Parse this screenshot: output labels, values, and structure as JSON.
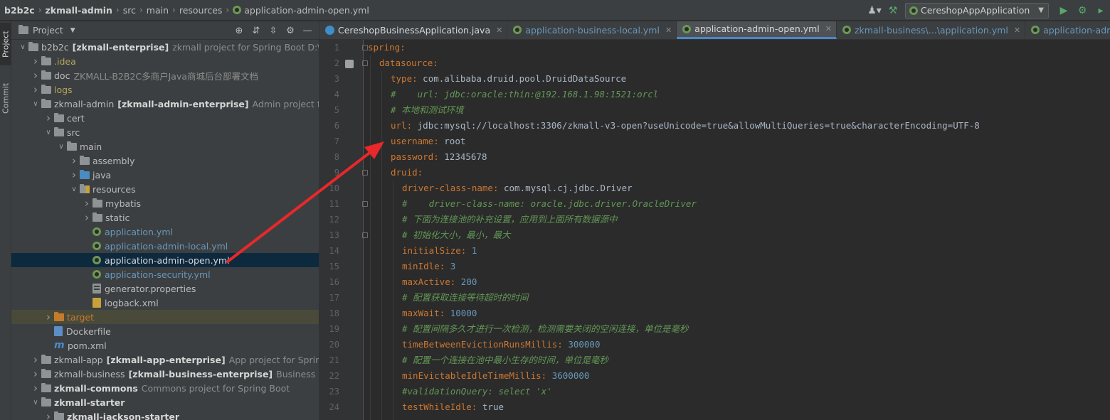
{
  "navbar": {
    "crumbs": [
      "b2b2c",
      "zkmall-admin",
      "src",
      "main",
      "resources",
      "application-admin-open.yml"
    ],
    "run_config": "CereshopAppApplication"
  },
  "stripe": {
    "project_label": "Project",
    "commit_label": "Commit"
  },
  "project_panel": {
    "title": "Project",
    "tree": [
      {
        "name": "b2b2c",
        "bold": "[zkmall-enterprise]",
        "dim": "zkmall project for Spring Boot  D:\\yixian",
        "depth": 0,
        "expanded": true,
        "kind": "folder"
      },
      {
        "name": ".idea",
        "depth": 1,
        "expanded": false,
        "kind": "folder",
        "color": "yellow"
      },
      {
        "name": "doc",
        "dim": "ZKMALL-B2B2C多商户Java商城后台部署文档",
        "depth": 1,
        "expanded": false,
        "kind": "folder"
      },
      {
        "name": "logs",
        "depth": 1,
        "expanded": false,
        "kind": "folder",
        "color": "yellow"
      },
      {
        "name": "zkmall-admin",
        "bold": "[zkmall-admin-enterprise]",
        "dim": "Admin project for Sprin",
        "depth": 1,
        "expanded": true,
        "kind": "folder"
      },
      {
        "name": "cert",
        "depth": 2,
        "expanded": false,
        "kind": "folder"
      },
      {
        "name": "src",
        "depth": 2,
        "expanded": true,
        "kind": "folder"
      },
      {
        "name": "main",
        "depth": 3,
        "expanded": true,
        "kind": "folder"
      },
      {
        "name": "assembly",
        "depth": 4,
        "expanded": false,
        "kind": "folder"
      },
      {
        "name": "java",
        "depth": 4,
        "expanded": false,
        "kind": "folder-blue"
      },
      {
        "name": "resources",
        "depth": 4,
        "expanded": true,
        "kind": "folder-res"
      },
      {
        "name": "mybatis",
        "depth": 5,
        "expanded": false,
        "kind": "folder"
      },
      {
        "name": "static",
        "depth": 5,
        "expanded": false,
        "kind": "folder"
      },
      {
        "name": "application.yml",
        "depth": 5,
        "kind": "yml",
        "color": "blue"
      },
      {
        "name": "application-admin-local.yml",
        "depth": 5,
        "kind": "yml",
        "color": "blue"
      },
      {
        "name": "application-admin-open.yml",
        "depth": 5,
        "kind": "yml",
        "color": "white",
        "selected": true
      },
      {
        "name": "application-security.yml",
        "depth": 5,
        "kind": "yml",
        "color": "blue"
      },
      {
        "name": "generator.properties",
        "depth": 5,
        "kind": "props"
      },
      {
        "name": "logback.xml",
        "depth": 5,
        "kind": "xml"
      },
      {
        "name": "target",
        "depth": 2,
        "expanded": false,
        "kind": "folder-orange",
        "color": "orange",
        "excluded": true
      },
      {
        "name": "Dockerfile",
        "depth": 2,
        "kind": "docker"
      },
      {
        "name": "pom.xml",
        "depth": 2,
        "kind": "maven"
      },
      {
        "name": "zkmall-app",
        "bold": "[zkmall-app-enterprise]",
        "dim": "App project for Spring Boo",
        "depth": 1,
        "expanded": false,
        "kind": "folder"
      },
      {
        "name": "zkmall-business",
        "bold": "[zkmall-business-enterprise]",
        "dim": "Business project",
        "depth": 1,
        "expanded": false,
        "kind": "folder"
      },
      {
        "name": "",
        "bold": "zkmall-commons",
        "dim": "Commons project for Spring Boot",
        "depth": 1,
        "expanded": false,
        "kind": "folder"
      },
      {
        "name": "",
        "bold": "zkmall-starter",
        "depth": 1,
        "expanded": true,
        "kind": "folder"
      },
      {
        "name": "",
        "bold": "zkmall-jackson-starter",
        "depth": 2,
        "expanded": false,
        "kind": "folder"
      }
    ]
  },
  "editor": {
    "tabs": [
      {
        "label": "CereshopBusinessApplication.java",
        "kind": "java"
      },
      {
        "label": "application-business-local.yml",
        "kind": "yml"
      },
      {
        "label": "application-admin-open.yml",
        "kind": "yml",
        "active": true
      },
      {
        "label": "zkmall-business\\...\\application.yml",
        "kind": "yml"
      },
      {
        "label": "application-admin-local.",
        "kind": "yml"
      }
    ],
    "lines": [
      {
        "n": "1",
        "indent": 0,
        "key": "spring",
        "val": ""
      },
      {
        "n": "2",
        "indent": 1,
        "key": "datasource",
        "val": ""
      },
      {
        "n": "3",
        "indent": 2,
        "key": "type",
        "val": "com.alibaba.druid.pool.DruidDataSource"
      },
      {
        "n": "4",
        "indent": 2,
        "comment": "#    url: jdbc:oracle:thin:@192.168.1.98:1521:orcl"
      },
      {
        "n": "5",
        "indent": 2,
        "comment": "# 本地和测试环境"
      },
      {
        "n": "6",
        "indent": 2,
        "key": "url",
        "val": "jdbc:mysql://localhost:3306/zkmall-v3-open?useUnicode=true&allowMultiQueries=true&characterEncoding=UTF-8"
      },
      {
        "n": "7",
        "indent": 2,
        "key": "username",
        "val": "root"
      },
      {
        "n": "8",
        "indent": 2,
        "key": "password",
        "val": "12345678"
      },
      {
        "n": "9",
        "indent": 2,
        "key": "druid",
        "val": ""
      },
      {
        "n": "10",
        "indent": 3,
        "key": "driver-class-name",
        "val": "com.mysql.cj.jdbc.Driver"
      },
      {
        "n": "11",
        "indent": 3,
        "comment": "#    driver-class-name: oracle.jdbc.driver.OracleDriver"
      },
      {
        "n": "12",
        "indent": 3,
        "comment": "# 下面为连接池的补充设置，应用到上面所有数据源中"
      },
      {
        "n": "13",
        "indent": 3,
        "comment": "# 初始化大小，最小，最大"
      },
      {
        "n": "14",
        "indent": 3,
        "key": "initialSize",
        "num": "1"
      },
      {
        "n": "15",
        "indent": 3,
        "key": "minIdle",
        "num": "3"
      },
      {
        "n": "16",
        "indent": 3,
        "key": "maxActive",
        "num": "200"
      },
      {
        "n": "17",
        "indent": 3,
        "comment": "# 配置获取连接等待超时的时间"
      },
      {
        "n": "18",
        "indent": 3,
        "key": "maxWait",
        "num": "10000"
      },
      {
        "n": "19",
        "indent": 3,
        "comment": "# 配置间隔多久才进行一次检测，检测需要关闭的空闲连接，单位是毫秒"
      },
      {
        "n": "20",
        "indent": 3,
        "key": "timeBetweenEvictionRunsMillis",
        "num": "300000"
      },
      {
        "n": "21",
        "indent": 3,
        "comment": "# 配置一个连接在池中最小生存的时间，单位是毫秒"
      },
      {
        "n": "22",
        "indent": 3,
        "key": "minEvictableIdleTimeMillis",
        "num": "3600000"
      },
      {
        "n": "23",
        "indent": 3,
        "comment": "#validationQuery: select 'x'"
      },
      {
        "n": "24",
        "indent": 3,
        "key": "testWhileIdle",
        "val": "true"
      }
    ]
  },
  "colors": {
    "accent": "#4a88c7",
    "annotation_arrow": "#e8282a",
    "yaml_key": "#cc7832",
    "comment": "#629755",
    "number": "#6897bb"
  }
}
